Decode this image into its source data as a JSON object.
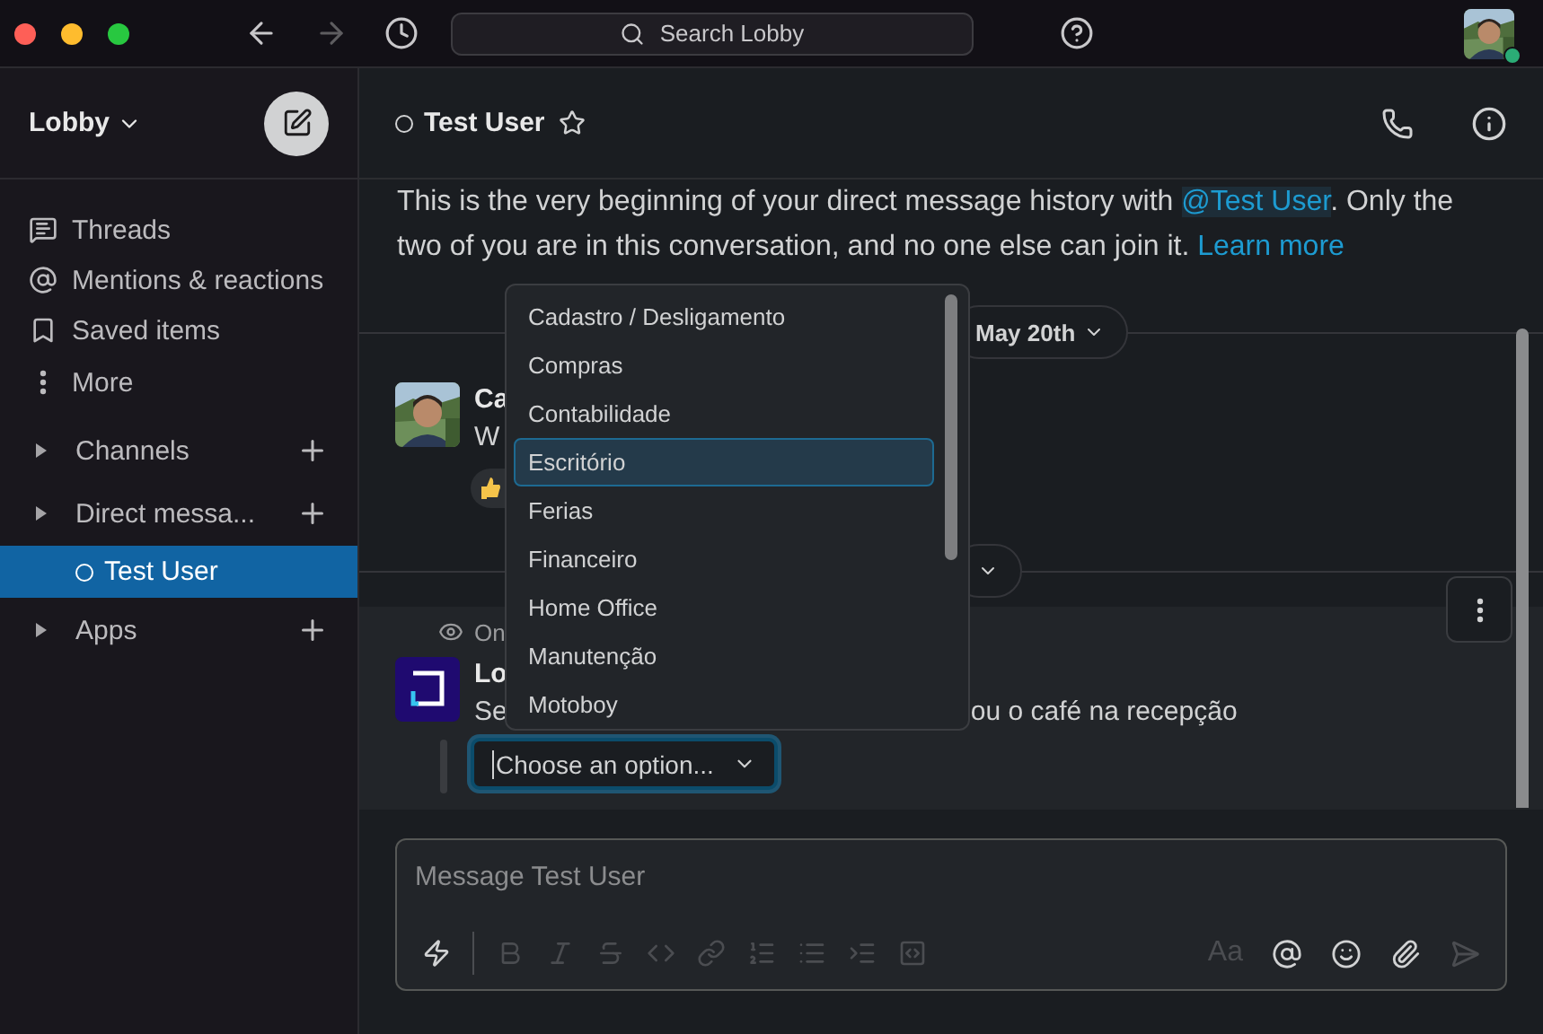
{
  "titlebar": {
    "nav": [
      {
        "kind": "back",
        "disabled": false
      },
      {
        "kind": "forward",
        "disabled": true
      },
      {
        "kind": "history",
        "disabled": false
      }
    ],
    "search": {
      "placeholder": "Search Lobby"
    },
    "presence_online": true
  },
  "sidebar": {
    "workspace": "Lobby",
    "items": [
      {
        "kind": "nav",
        "label": "Threads",
        "selected": false
      },
      {
        "kind": "nav",
        "label": "Mentions & reactions",
        "selected": false
      },
      {
        "kind": "nav",
        "label": "Saved items",
        "selected": false
      },
      {
        "kind": "nav",
        "label": "More",
        "selected": false
      },
      {
        "kind": "section",
        "label": "Channels",
        "expanded": false
      },
      {
        "kind": "section",
        "label": "Direct messa...",
        "expanded": false
      },
      {
        "kind": "dm",
        "label": "Test User",
        "selected": true,
        "online": false
      },
      {
        "kind": "section",
        "label": "Apps",
        "expanded": false
      }
    ]
  },
  "header": {
    "title": "Test User",
    "online": false,
    "starred": false
  },
  "intro": {
    "before": "This is the very beginning of your direct message history with ",
    "mention": "@Test User",
    "after": ". Only the two of you are in this conversation, and no one else can join it.",
    "link": "Learn more"
  },
  "date_divider": {
    "label": "May 20th"
  },
  "messages": [
    {
      "kind": "user",
      "sender": "Ca",
      "text": "W",
      "reaction": true
    },
    {
      "kind": "bot",
      "note": "On",
      "sender": "Lo",
      "text_start": "Se",
      "text_end": "ou o café na recepção",
      "select": {
        "placeholder": "Choose an option...",
        "focused": true
      }
    }
  ],
  "dropdown": {
    "options": [
      {
        "label": "Cadastro / Desligamento",
        "selected": false
      },
      {
        "label": "Compras",
        "selected": false
      },
      {
        "label": "Contabilidade",
        "selected": false
      },
      {
        "label": "Escritório",
        "selected": true
      },
      {
        "label": "Ferias",
        "selected": false
      },
      {
        "label": "Financeiro",
        "selected": false
      },
      {
        "label": "Home Office",
        "selected": false
      },
      {
        "label": "Manutenção",
        "selected": false
      },
      {
        "label": "Motoboy",
        "selected": false
      }
    ]
  },
  "composer": {
    "placeholder": "Message Test User",
    "format_toggle": "Aa",
    "tools": [
      {
        "kind": "shortcuts",
        "disabled": false
      },
      {
        "kind": "bold",
        "disabled": true
      },
      {
        "kind": "italic",
        "disabled": true
      },
      {
        "kind": "strike",
        "disabled": true
      },
      {
        "kind": "code",
        "disabled": true
      },
      {
        "kind": "link",
        "disabled": true
      },
      {
        "kind": "ordered",
        "disabled": true
      },
      {
        "kind": "bullets",
        "disabled": true
      },
      {
        "kind": "quote",
        "disabled": true
      },
      {
        "kind": "codeblock",
        "disabled": true
      }
    ],
    "actions": [
      {
        "kind": "mention",
        "disabled": false
      },
      {
        "kind": "emoji",
        "disabled": false
      },
      {
        "kind": "attach",
        "disabled": false
      },
      {
        "kind": "send",
        "disabled": true
      }
    ]
  }
}
